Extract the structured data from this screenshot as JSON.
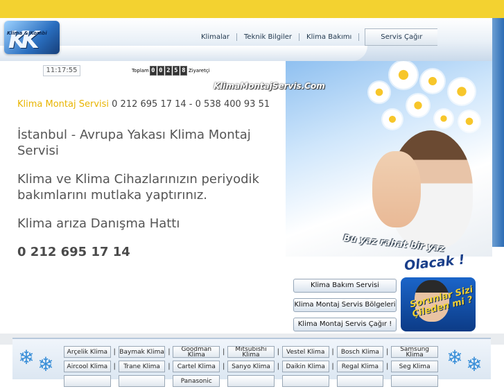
{
  "logo": {
    "text": "Klima & Kombi"
  },
  "nav": {
    "items": [
      "Klimalar",
      "Teknik Bilgiler",
      "Klima Bakımı",
      "Servis Çağır"
    ]
  },
  "clock": {
    "time": "11:17:55"
  },
  "counter": {
    "prefix": "Toplam",
    "digits": "00258",
    "suffix": "Ziyaretçi"
  },
  "hero": {
    "site": "KlimaMontajServis.Com",
    "slogan_line1": "Bu yaz rahat bir yaz",
    "slogan_line2": "Olacak !"
  },
  "contact": {
    "label": "Klima Montaj Servisi",
    "phones": " 0 212 695 17 14 - 0 538 400 93 51"
  },
  "main": {
    "p1": "İstanbul - Avrupa Yakası Klima Montaj Servisi",
    "p2": "Klima ve Klima Cihazlarınızın periyodik bakımlarını mutlaka yaptırınız.",
    "p3": "Klima arıza Danışma Hattı",
    "phone": "0 212 695 17 14"
  },
  "side_buttons": [
    "Klima Bakım Servisi",
    "Klima Montaj Servis Bölgeleri",
    "Klima Montaj Servis Çağır !"
  ],
  "promo": {
    "text": "Sorunlar Sizi Çileden mi ?"
  },
  "brands": {
    "row1": [
      "Arçelik Klima",
      "Baymak Klima",
      "Goodman Klima",
      "Mitsubishi Klima",
      "Vestel Klima",
      "Bosch Klima",
      "Samsung Klima"
    ],
    "row2": [
      "Aircool Klima",
      "Trane Klima",
      "Cartel Klima",
      "Sanyo Klima",
      "Daikin Klima",
      "Regal Klima",
      "Seg Klima"
    ],
    "row3": [
      "",
      "",
      "Panasonic",
      "",
      "",
      "",
      ""
    ]
  }
}
